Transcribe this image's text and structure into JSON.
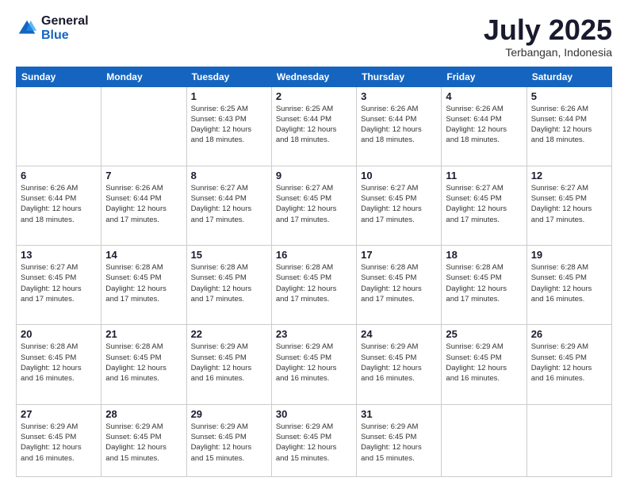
{
  "logo": {
    "general": "General",
    "blue": "Blue"
  },
  "header": {
    "month": "July 2025",
    "location": "Terbangan, Indonesia"
  },
  "weekdays": [
    "Sunday",
    "Monday",
    "Tuesday",
    "Wednesday",
    "Thursday",
    "Friday",
    "Saturday"
  ],
  "weeks": [
    [
      {
        "day": "",
        "info": ""
      },
      {
        "day": "",
        "info": ""
      },
      {
        "day": "1",
        "info": "Sunrise: 6:25 AM\nSunset: 6:43 PM\nDaylight: 12 hours\nand 18 minutes."
      },
      {
        "day": "2",
        "info": "Sunrise: 6:25 AM\nSunset: 6:44 PM\nDaylight: 12 hours\nand 18 minutes."
      },
      {
        "day": "3",
        "info": "Sunrise: 6:26 AM\nSunset: 6:44 PM\nDaylight: 12 hours\nand 18 minutes."
      },
      {
        "day": "4",
        "info": "Sunrise: 6:26 AM\nSunset: 6:44 PM\nDaylight: 12 hours\nand 18 minutes."
      },
      {
        "day": "5",
        "info": "Sunrise: 6:26 AM\nSunset: 6:44 PM\nDaylight: 12 hours\nand 18 minutes."
      }
    ],
    [
      {
        "day": "6",
        "info": "Sunrise: 6:26 AM\nSunset: 6:44 PM\nDaylight: 12 hours\nand 18 minutes."
      },
      {
        "day": "7",
        "info": "Sunrise: 6:26 AM\nSunset: 6:44 PM\nDaylight: 12 hours\nand 17 minutes."
      },
      {
        "day": "8",
        "info": "Sunrise: 6:27 AM\nSunset: 6:44 PM\nDaylight: 12 hours\nand 17 minutes."
      },
      {
        "day": "9",
        "info": "Sunrise: 6:27 AM\nSunset: 6:45 PM\nDaylight: 12 hours\nand 17 minutes."
      },
      {
        "day": "10",
        "info": "Sunrise: 6:27 AM\nSunset: 6:45 PM\nDaylight: 12 hours\nand 17 minutes."
      },
      {
        "day": "11",
        "info": "Sunrise: 6:27 AM\nSunset: 6:45 PM\nDaylight: 12 hours\nand 17 minutes."
      },
      {
        "day": "12",
        "info": "Sunrise: 6:27 AM\nSunset: 6:45 PM\nDaylight: 12 hours\nand 17 minutes."
      }
    ],
    [
      {
        "day": "13",
        "info": "Sunrise: 6:27 AM\nSunset: 6:45 PM\nDaylight: 12 hours\nand 17 minutes."
      },
      {
        "day": "14",
        "info": "Sunrise: 6:28 AM\nSunset: 6:45 PM\nDaylight: 12 hours\nand 17 minutes."
      },
      {
        "day": "15",
        "info": "Sunrise: 6:28 AM\nSunset: 6:45 PM\nDaylight: 12 hours\nand 17 minutes."
      },
      {
        "day": "16",
        "info": "Sunrise: 6:28 AM\nSunset: 6:45 PM\nDaylight: 12 hours\nand 17 minutes."
      },
      {
        "day": "17",
        "info": "Sunrise: 6:28 AM\nSunset: 6:45 PM\nDaylight: 12 hours\nand 17 minutes."
      },
      {
        "day": "18",
        "info": "Sunrise: 6:28 AM\nSunset: 6:45 PM\nDaylight: 12 hours\nand 17 minutes."
      },
      {
        "day": "19",
        "info": "Sunrise: 6:28 AM\nSunset: 6:45 PM\nDaylight: 12 hours\nand 16 minutes."
      }
    ],
    [
      {
        "day": "20",
        "info": "Sunrise: 6:28 AM\nSunset: 6:45 PM\nDaylight: 12 hours\nand 16 minutes."
      },
      {
        "day": "21",
        "info": "Sunrise: 6:28 AM\nSunset: 6:45 PM\nDaylight: 12 hours\nand 16 minutes."
      },
      {
        "day": "22",
        "info": "Sunrise: 6:29 AM\nSunset: 6:45 PM\nDaylight: 12 hours\nand 16 minutes."
      },
      {
        "day": "23",
        "info": "Sunrise: 6:29 AM\nSunset: 6:45 PM\nDaylight: 12 hours\nand 16 minutes."
      },
      {
        "day": "24",
        "info": "Sunrise: 6:29 AM\nSunset: 6:45 PM\nDaylight: 12 hours\nand 16 minutes."
      },
      {
        "day": "25",
        "info": "Sunrise: 6:29 AM\nSunset: 6:45 PM\nDaylight: 12 hours\nand 16 minutes."
      },
      {
        "day": "26",
        "info": "Sunrise: 6:29 AM\nSunset: 6:45 PM\nDaylight: 12 hours\nand 16 minutes."
      }
    ],
    [
      {
        "day": "27",
        "info": "Sunrise: 6:29 AM\nSunset: 6:45 PM\nDaylight: 12 hours\nand 16 minutes."
      },
      {
        "day": "28",
        "info": "Sunrise: 6:29 AM\nSunset: 6:45 PM\nDaylight: 12 hours\nand 15 minutes."
      },
      {
        "day": "29",
        "info": "Sunrise: 6:29 AM\nSunset: 6:45 PM\nDaylight: 12 hours\nand 15 minutes."
      },
      {
        "day": "30",
        "info": "Sunrise: 6:29 AM\nSunset: 6:45 PM\nDaylight: 12 hours\nand 15 minutes."
      },
      {
        "day": "31",
        "info": "Sunrise: 6:29 AM\nSunset: 6:45 PM\nDaylight: 12 hours\nand 15 minutes."
      },
      {
        "day": "",
        "info": ""
      },
      {
        "day": "",
        "info": ""
      }
    ]
  ]
}
